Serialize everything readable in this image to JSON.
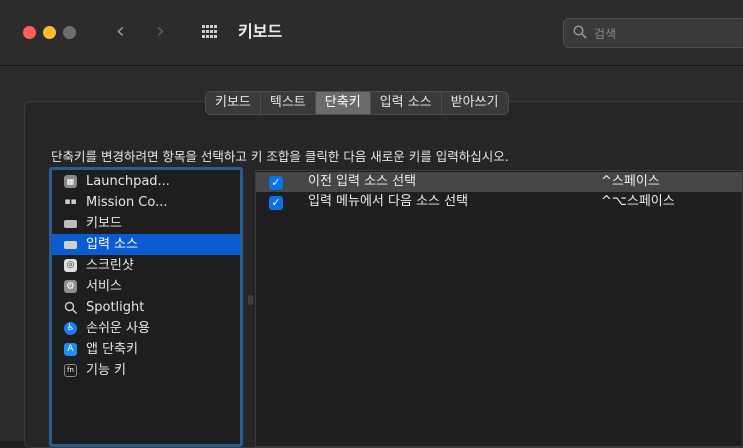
{
  "window": {
    "title": "키보드",
    "search_placeholder": "검색",
    "traffic_lights": {
      "close": "#ff5f57",
      "minimize": "#febc2e",
      "zoom": "#6e6e6e"
    }
  },
  "tabs": [
    {
      "label": "키보드",
      "active": false
    },
    {
      "label": "텍스트",
      "active": false
    },
    {
      "label": "단축키",
      "active": true
    },
    {
      "label": "입력 소스",
      "active": false
    },
    {
      "label": "받아쓰기",
      "active": false
    }
  ],
  "instruction": "단축키를 변경하려면 항목을 선택하고 키 조합을 클릭한 다음 새로운 키를 입력하십시오.",
  "sidebar": {
    "items": [
      {
        "label": "Launchpad...",
        "icon": "launchpad-icon",
        "selected": false
      },
      {
        "label": "Mission Co...",
        "icon": "mission-control-icon",
        "selected": false
      },
      {
        "label": "키보드",
        "icon": "keyboard-icon",
        "selected": false
      },
      {
        "label": "입력 소스",
        "icon": "input-source-icon",
        "selected": true
      },
      {
        "label": "스크린샷",
        "icon": "screenshot-icon",
        "selected": false
      },
      {
        "label": "서비스",
        "icon": "services-gear-icon",
        "selected": false
      },
      {
        "label": "Spotlight",
        "icon": "spotlight-search-icon",
        "selected": false
      },
      {
        "label": "손쉬운 사용",
        "icon": "accessibility-icon",
        "selected": false
      },
      {
        "label": "앱 단축키",
        "icon": "app-store-icon",
        "selected": false
      },
      {
        "label": "기능 키",
        "icon": "fn-key-icon",
        "selected": false
      }
    ]
  },
  "shortcuts": [
    {
      "label": "이전 입력 소스 선택",
      "key": "^스페이스",
      "checked": true,
      "selected": true
    },
    {
      "label": "입력 메뉴에서 다음 소스 선택",
      "key": "^⌥스페이스",
      "checked": true,
      "selected": false
    }
  ],
  "colors": {
    "accent": "#0b5cd0",
    "checkbox": "#0a72e8",
    "focus_ring": "#295c92"
  }
}
